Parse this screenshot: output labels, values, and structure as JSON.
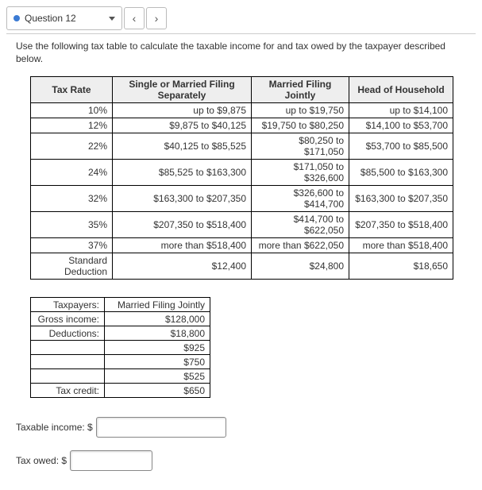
{
  "topbar": {
    "question_label": "Question 12",
    "prev": "‹",
    "next": "›"
  },
  "instructions": "Use the following tax table to calculate the taxable income for and tax owed by the taxpayer described below.",
  "tax_table": {
    "headers": [
      "Tax Rate",
      "Single or Married Filing Separately",
      "Married Filing Jointly",
      "Head of Household"
    ],
    "rows": [
      {
        "rate": "10%",
        "single": "up to $9,875",
        "joint": "up to $19,750",
        "hoh": "up to $14,100"
      },
      {
        "rate": "12%",
        "single": "$9,875 to $40,125",
        "joint": "$19,750 to $80,250",
        "hoh": "$14,100 to $53,700"
      },
      {
        "rate": "22%",
        "single": "$40,125 to $85,525",
        "joint": "$80,250 to $171,050",
        "hoh": "$53,700 to $85,500"
      },
      {
        "rate": "24%",
        "single": "$85,525 to $163,300",
        "joint": "$171,050 to $326,600",
        "hoh": "$85,500 to $163,300"
      },
      {
        "rate": "32%",
        "single": "$163,300 to $207,350",
        "joint": "$326,600 to $414,700",
        "hoh": "$163,300 to $207,350"
      },
      {
        "rate": "35%",
        "single": "$207,350 to $518,400",
        "joint": "$414,700 to $622,050",
        "hoh": "$207,350 to $518,400"
      },
      {
        "rate": "37%",
        "single": "more than $518,400",
        "joint": "more than $622,050",
        "hoh": "more than $518,400"
      },
      {
        "rate": "Standard Deduction",
        "single": "$12,400",
        "joint": "$24,800",
        "hoh": "$18,650"
      }
    ]
  },
  "payer": {
    "rows": [
      {
        "label": "Taxpayers:",
        "value": "Married Filing Jointly"
      },
      {
        "label": "Gross income:",
        "value": "$128,000"
      },
      {
        "label": "Deductions:",
        "value": "$18,800"
      },
      {
        "label": "",
        "value": "$925"
      },
      {
        "label": "",
        "value": "$750"
      },
      {
        "label": "",
        "value": "$525"
      },
      {
        "label": "Tax credit:",
        "value": "$650"
      }
    ]
  },
  "inputs": {
    "taxable_label": "Taxable income: $",
    "owed_label": "Tax owed: $",
    "taxable_value": "",
    "owed_value": ""
  }
}
